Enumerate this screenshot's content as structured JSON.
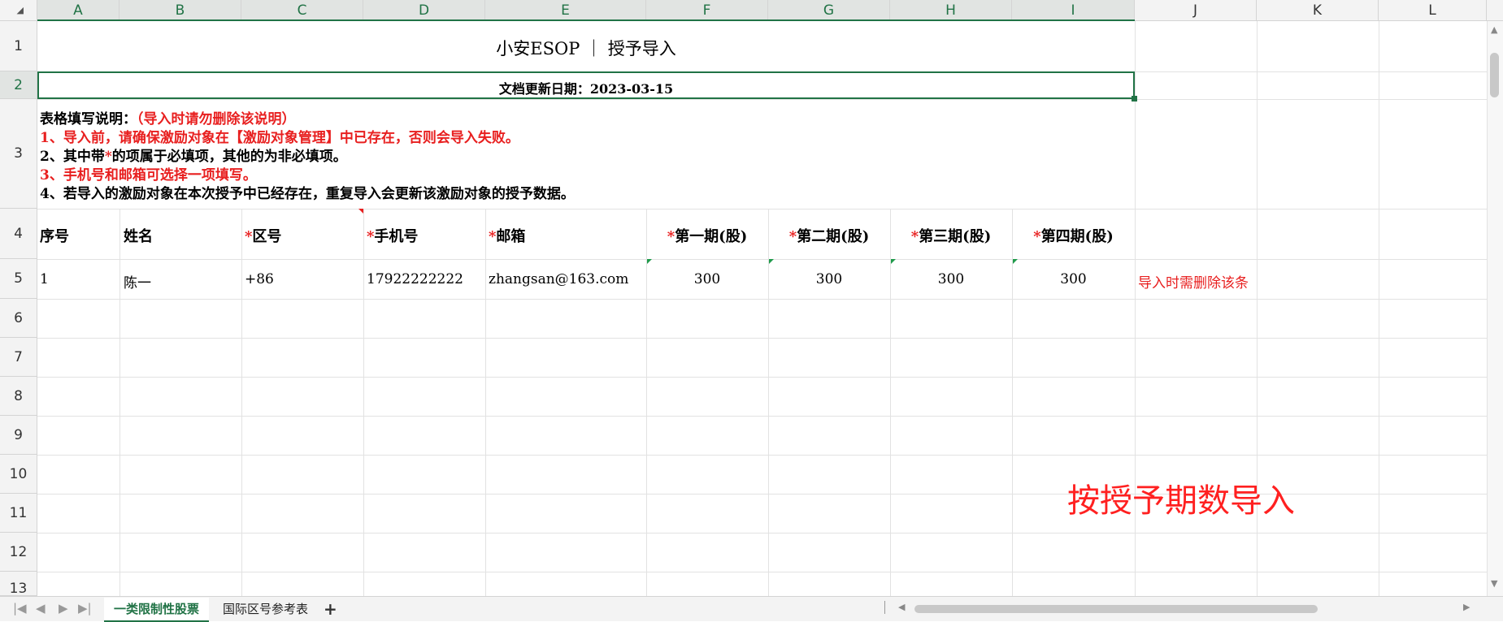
{
  "columns": [
    "A",
    "B",
    "C",
    "D",
    "E",
    "F",
    "G",
    "H",
    "I",
    "J",
    "K",
    "L"
  ],
  "rows": [
    "1",
    "2",
    "3",
    "4",
    "5",
    "6",
    "7",
    "8",
    "9",
    "10",
    "11",
    "12",
    "13"
  ],
  "title": "小安ESOP ｜ 授予导入",
  "update_date": "文档更新日期：2023-03-15",
  "instructions": {
    "heading": "表格填写说明：",
    "heading_note": "（导入时请勿删除该说明）",
    "line1": "1、导入前，请确保激励对象在【激励对象管理】中已存在，否则会导入失败。",
    "line2_pre": "2、其中带",
    "line2_star": "*",
    "line2_post": "的项属于必填项，其他的为非必填项。",
    "line3": "3、手机号和邮箱可选择一项填写。",
    "line4": "4、若导入的激励对象在本次授予中已经存在，重复导入会更新该激励对象的授予数据。"
  },
  "headers": {
    "seq": "序号",
    "name": "姓名",
    "area": "区号",
    "phone": "手机号",
    "email": "邮箱",
    "p1": "第一期(股)",
    "p2": "第二期(股)",
    "p3": "第三期(股)",
    "p4": "第四期(股)",
    "star": "*"
  },
  "example_row": {
    "seq": "1",
    "name": "陈一",
    "area": "+86",
    "phone": "17922222222",
    "email": "zhangsan@163.com",
    "p1": "300",
    "p2": "300",
    "p3": "300",
    "p4": "300",
    "note": "导入时需删除该条"
  },
  "annotation": "按授予期数导入",
  "sheets": [
    {
      "label": "一类限制性股票",
      "active": true
    },
    {
      "label": "国际区号参考表",
      "active": false
    }
  ],
  "icons": {
    "first": "first-sheet-icon",
    "prev": "prev-sheet-icon",
    "next": "next-sheet-icon",
    "last": "last-sheet-icon",
    "add": "add-sheet-icon"
  },
  "colors": {
    "accent": "#217346",
    "red": "#e81f1f"
  }
}
